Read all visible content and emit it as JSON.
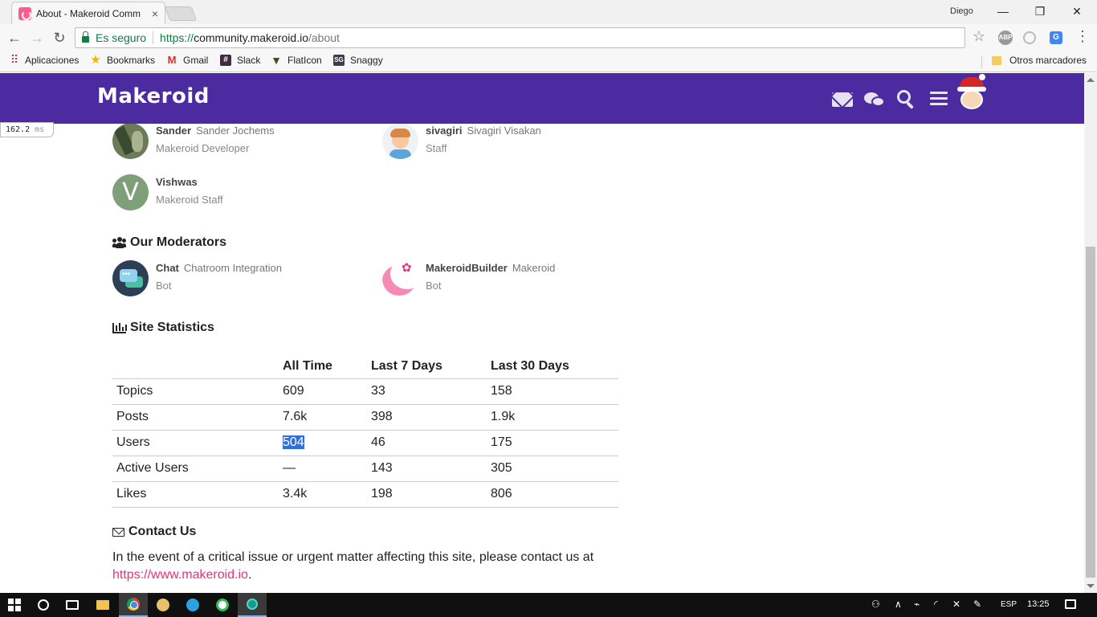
{
  "browser": {
    "tab_title": "About - Makeroid Comm",
    "tab_close": "×",
    "user_label": "Diego",
    "window_minimize": "—",
    "window_restore": "❐",
    "window_close": "✕",
    "nav_back": "←",
    "nav_forward": "→",
    "nav_reload": "↻",
    "secure_label": "Es seguro",
    "url_scheme": "https://",
    "url_host": "community.makeroid.io",
    "url_path": "/about",
    "bookmark_star": "☆",
    "ext_abp": "ABP",
    "ext_translate": "G",
    "ext_menu": "⋮",
    "bookmarks": [
      {
        "label": "Aplicaciones",
        "icon": "apps-icon"
      },
      {
        "label": "Bookmarks",
        "icon": "star-icon"
      },
      {
        "label": "Gmail",
        "icon": "gmail-icon"
      },
      {
        "label": "Slack",
        "icon": "slack-icon"
      },
      {
        "label": "FlatIcon",
        "icon": "flaticon-icon"
      },
      {
        "label": "Snaggy",
        "icon": "snaggy-icon"
      }
    ],
    "other_bookmarks": "Otros marcadores"
  },
  "timer": {
    "value": "162.2",
    "unit": "ms"
  },
  "site": {
    "logo": "Makeroid",
    "accent": "#4c2ba1",
    "link_color": "#e5337a"
  },
  "staff": [
    {
      "username": "Sander",
      "fullname": "Sander Jochems",
      "title": "Makeroid Developer"
    },
    {
      "username": "sivagiri",
      "fullname": "Sivagiri Visakan",
      "title": "Staff"
    },
    {
      "username": "Vishwas",
      "fullname": "",
      "title": "Makeroid Staff",
      "initial": "V"
    }
  ],
  "moderators": {
    "heading": "Our Moderators",
    "people": [
      {
        "username": "Chat",
        "fullname": "Chatroom Integration",
        "title": "Bot"
      },
      {
        "username": "MakeroidBuilder",
        "fullname": "Makeroid",
        "title": "Bot"
      }
    ]
  },
  "stats": {
    "heading": "Site Statistics",
    "columns": [
      "",
      "All Time",
      "Last 7 Days",
      "Last 30 Days"
    ],
    "rows": [
      {
        "label": "Topics",
        "all_time": "609",
        "last_7": "33",
        "last_30": "158"
      },
      {
        "label": "Posts",
        "all_time": "7.6k",
        "last_7": "398",
        "last_30": "1.9k"
      },
      {
        "label": "Users",
        "all_time": "504",
        "last_7": "46",
        "last_30": "175"
      },
      {
        "label": "Active Users",
        "all_time": "—",
        "last_7": "143",
        "last_30": "305"
      },
      {
        "label": "Likes",
        "all_time": "3.4k",
        "last_7": "198",
        "last_30": "806"
      }
    ]
  },
  "contact": {
    "heading": "Contact Us",
    "text": "In the event of a critical issue or urgent matter affecting this site, please contact us at",
    "link": "https://www.makeroid.io",
    "period": "."
  },
  "taskbar": {
    "language": "ESP",
    "time": "13:25"
  }
}
